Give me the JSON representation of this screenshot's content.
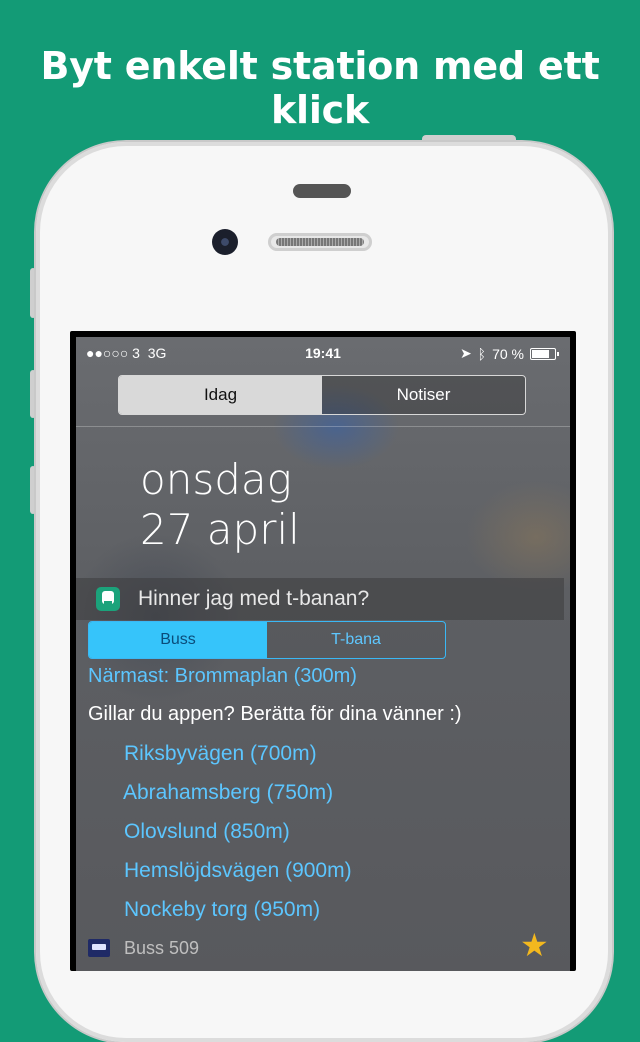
{
  "headline": "Byt enkelt station med ett klick",
  "status_bar": {
    "carrier": "●●○○○ 3",
    "network": "3G",
    "time": "19:41",
    "battery": "70 %"
  },
  "top_tabs": [
    "Idag",
    "Notiser"
  ],
  "date": {
    "weekday": "onsdag",
    "day_month": "27 april"
  },
  "widget": {
    "title": "Hinner jag med t-banan?",
    "modes": [
      "Buss",
      "T-bana"
    ],
    "nearest": "Närmast: Brommaplan (300m)",
    "promo": "Gillar du appen? Berätta för dina vänner :)",
    "stations": [
      "Riksbyvägen (700m)",
      "Abrahamsberg (750m)",
      "Olovslund (850m)",
      "Hemslöjdsvägen (900m)",
      "Nockeby torg (950m)"
    ],
    "bus_line": "Buss 509"
  },
  "colors": {
    "background": "#139b76",
    "accent": "#36c4fa",
    "star": "#f3b81e"
  }
}
